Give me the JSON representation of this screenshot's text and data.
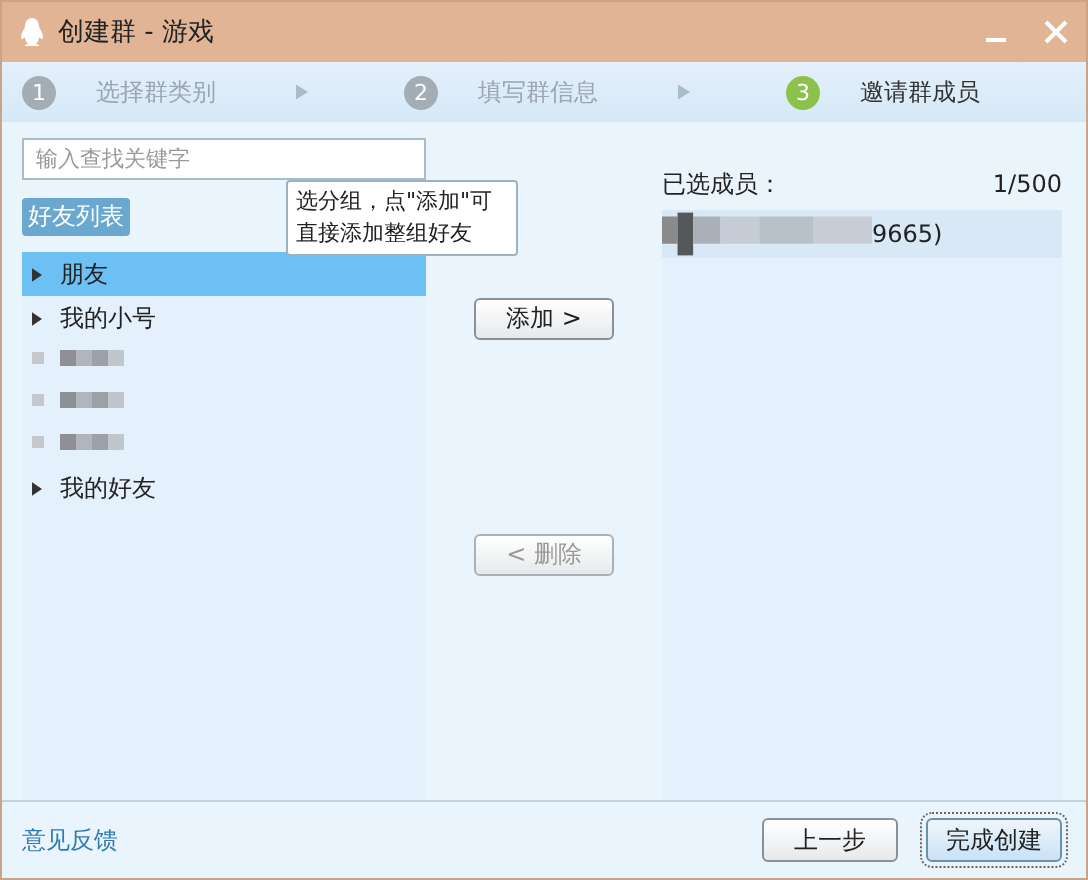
{
  "window": {
    "title": "创建群 - 游戏"
  },
  "steps": [
    {
      "number": "1",
      "label": "选择群类别",
      "selected": false
    },
    {
      "number": "2",
      "label": "填写群信息",
      "selected": false
    },
    {
      "number": "3",
      "label": "邀请群成员",
      "selected": true
    }
  ],
  "search": {
    "placeholder": "输入查找关键字"
  },
  "list_tag": "好友列表",
  "tooltip": "选分组，点\"添加\"可直接添加整组好友",
  "groups": [
    {
      "kind": "group",
      "label": "朋友",
      "selected": true
    },
    {
      "kind": "group",
      "label": "我的小号",
      "selected": false
    },
    {
      "kind": "blurred",
      "selected": false
    },
    {
      "kind": "blurred",
      "selected": false
    },
    {
      "kind": "blurred",
      "selected": false
    },
    {
      "kind": "group",
      "label": "我的好友",
      "selected": false
    }
  ],
  "add_button": "添加 >",
  "remove_button": {
    "label": "< 删除",
    "disabled": true
  },
  "selected_header": "已选成员：",
  "selected_count": "1/500",
  "members": [
    {
      "label": "9665)"
    }
  ],
  "feedback_link": "意见反馈",
  "buttons": [
    {
      "label": "上一步",
      "kind": "normal"
    },
    {
      "label": "完成创建",
      "kind": "primary"
    }
  ]
}
